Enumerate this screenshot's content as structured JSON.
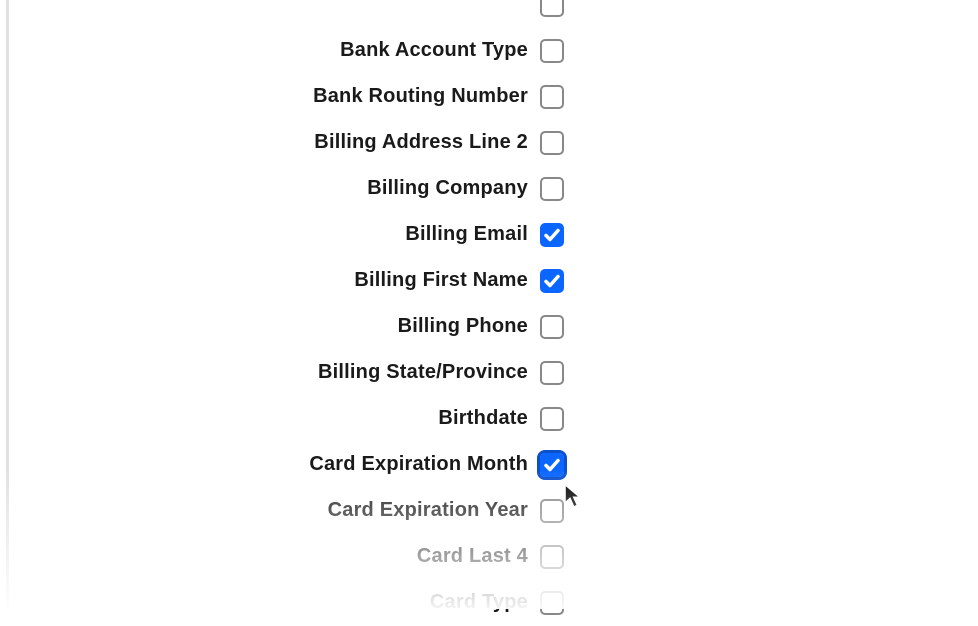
{
  "fields": [
    {
      "id": "field-0",
      "label": "",
      "checked": false,
      "focused": false
    },
    {
      "id": "bank-account-type",
      "label": "Bank Account Type",
      "checked": false,
      "focused": false
    },
    {
      "id": "bank-routing-number",
      "label": "Bank Routing Number",
      "checked": false,
      "focused": false
    },
    {
      "id": "billing-address-line-2",
      "label": "Billing Address Line 2",
      "checked": false,
      "focused": false
    },
    {
      "id": "billing-company",
      "label": "Billing Company",
      "checked": false,
      "focused": false
    },
    {
      "id": "billing-email",
      "label": "Billing Email",
      "checked": true,
      "focused": false
    },
    {
      "id": "billing-first-name",
      "label": "Billing First Name",
      "checked": true,
      "focused": false
    },
    {
      "id": "billing-phone",
      "label": "Billing Phone",
      "checked": false,
      "focused": false
    },
    {
      "id": "billing-state-province",
      "label": "Billing State/Province",
      "checked": false,
      "focused": false
    },
    {
      "id": "birthdate",
      "label": "Birthdate",
      "checked": false,
      "focused": false
    },
    {
      "id": "card-expiration-month",
      "label": "Card Expiration Month",
      "checked": true,
      "focused": true
    },
    {
      "id": "card-expiration-year",
      "label": "Card Expiration Year",
      "checked": false,
      "focused": false
    },
    {
      "id": "card-last-4",
      "label": "Card Last 4",
      "checked": false,
      "focused": false
    },
    {
      "id": "card-type",
      "label": "Card Type",
      "checked": false,
      "focused": false
    }
  ]
}
